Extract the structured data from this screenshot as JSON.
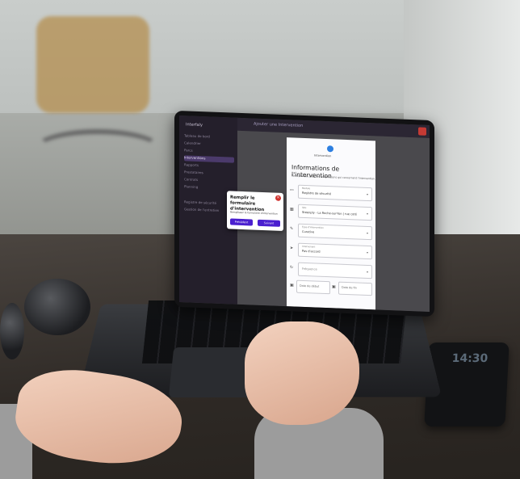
{
  "photo": {
    "subject": "laptop-with-app-screen",
    "colors": {
      "accent": "#4a1fcf",
      "danger": "#d0312d",
      "step": "#2d7fe0"
    }
  },
  "phone": {
    "time": "14:30"
  },
  "app": {
    "brand": "Interfaly",
    "page_title": "Ajouter une Intervention",
    "sidebar": {
      "items": [
        {
          "label": "Tableau de bord"
        },
        {
          "label": "Calendrier"
        },
        {
          "label": "Parcs"
        },
        {
          "label": "Interventions"
        },
        {
          "label": "Rapports"
        },
        {
          "label": "Prestataires"
        },
        {
          "label": "Contrats"
        },
        {
          "label": "Planning"
        },
        {
          "label": "Registre de sécurité"
        },
        {
          "label": "Gestion de l'entretien"
        }
      ]
    },
    "form": {
      "step_label": "Intervention",
      "title": "Informations de l'intervention",
      "subtitle": "Vous pouvez saisir les informations qui concernent l'intervention.",
      "fields": [
        {
          "label": "Module",
          "value": "Registre de sécurité"
        },
        {
          "label": "Site",
          "value": "Steenply - La Roche-sur-Yon | rue coté"
        },
        {
          "label": "Type d'intervention",
          "value": "Curative"
        },
        {
          "label": "Intervenant",
          "placeholder": "Pas d'accord"
        },
        {
          "label": "",
          "placeholder": "Fréquence"
        }
      ],
      "date_start": "Date de début",
      "date_end": "Date de fin"
    },
    "tour": {
      "title": "Remplir le formulaire d'intervention",
      "body": "Remplissez le formulaire d'intervention",
      "prev": "Précédent",
      "next": "Suivant"
    }
  }
}
